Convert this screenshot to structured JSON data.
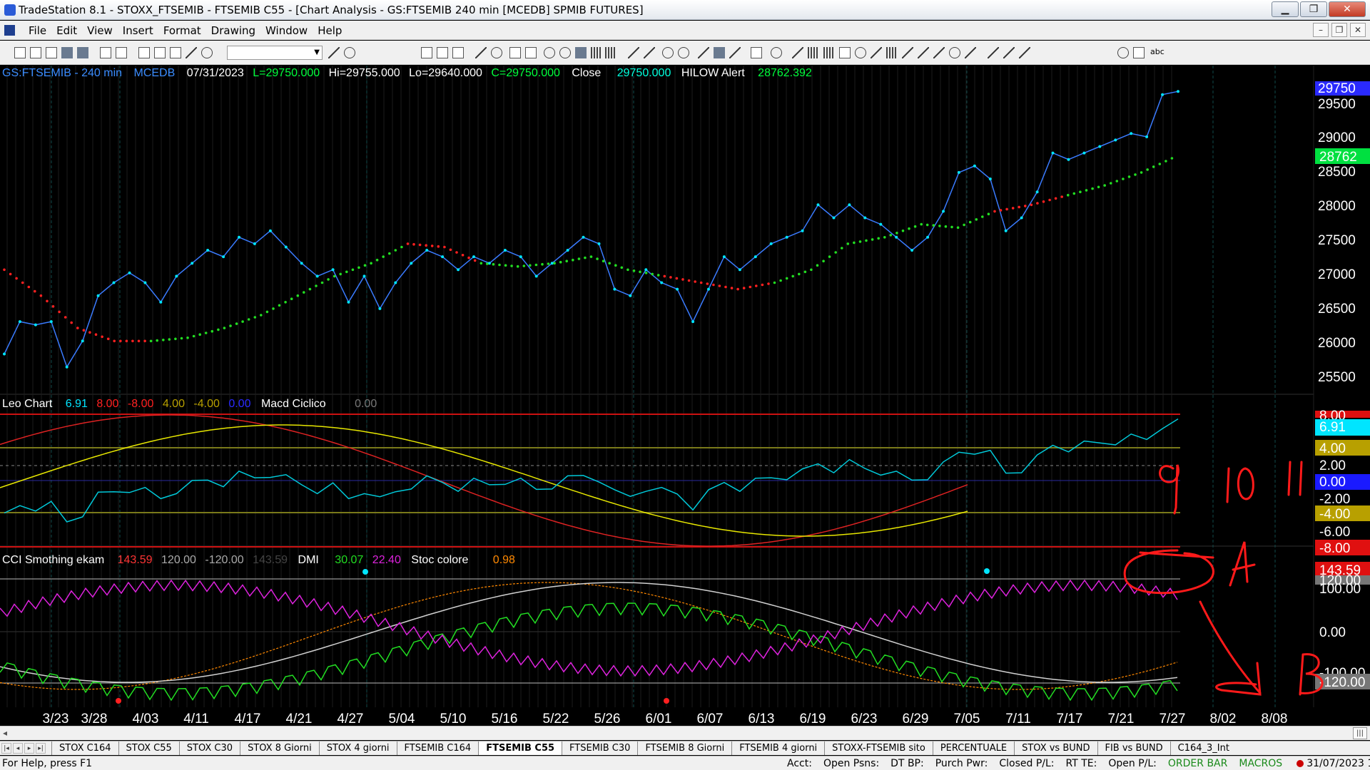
{
  "window": {
    "title": "TradeStation 8.1 - STOXX_FTSEMIB - FTSEMIB C55 - [Chart Analysis - GS:FTSEMIB  240 min  [MCEDB] SPMIB FUTURES]",
    "min_glyph": "▁",
    "max_glyph": "❐",
    "close_glyph": "✕"
  },
  "menu": {
    "items": [
      "File",
      "Edit",
      "View",
      "Insert",
      "Format",
      "Drawing",
      "Window",
      "Help"
    ],
    "mdi_min": "–",
    "mdi_restore": "❐",
    "mdi_close": "✕"
  },
  "toolbar": {
    "combo_value": "",
    "text_tool_label": "abc"
  },
  "chart": {
    "header": {
      "symbol": "GS:FTSEMIB - 240 min",
      "source": "MCEDB",
      "date": "07/31/2023",
      "low_open": "L=29750.000",
      "hi": "Hi=29755.000",
      "lo": "Lo=29640.000",
      "close_c": "C=29750.000",
      "close_label": "Close",
      "close_value": "29750.000",
      "alert_label": "HILOW Alert",
      "alert_value": "28762.392"
    },
    "panel2": {
      "name": "Leo Chart",
      "v1": "6.91",
      "v2": "8.00",
      "v3": "-8.00",
      "v4": "4.00",
      "v5": "-4.00",
      "v6": "0.00",
      "name2": "Macd Ciclico",
      "v7": "0.00"
    },
    "panel3": {
      "name": "CCI Smothing ekam",
      "v1": "143.59",
      "v2": "120.00",
      "v3": "-120.00",
      "v4": "143.59",
      "name2": "DMI",
      "v5": "30.07",
      "v6": "22.40",
      "name3": "Stoc colore",
      "v7": "0.98"
    },
    "price_axis": {
      "ticks": [
        "29500",
        "29000",
        "28500",
        "28000",
        "27500",
        "27000",
        "26500",
        "26000",
        "25500"
      ],
      "last_price_label": "29750",
      "alert_label": "28762"
    },
    "panel2_axis": {
      "ticks": [
        "4.00",
        "2.00",
        "0.00",
        "-2.00",
        "-4.00",
        "-6.00",
        "-8.00"
      ],
      "top_label": "8.00",
      "value_label": "6.91"
    },
    "panel3_axis": {
      "ticks": [
        "100.00",
        "0.00",
        "-100.00"
      ],
      "labels": [
        "143.59",
        "120.00",
        "-120.00"
      ]
    },
    "x_axis": [
      "3/23",
      "3/28",
      "4/03",
      "4/11",
      "4/17",
      "4/21",
      "4/27",
      "5/04",
      "5/10",
      "5/16",
      "5/22",
      "5/26",
      "6/01",
      "6/07",
      "6/13",
      "6/19",
      "6/23",
      "6/29",
      "7/05",
      "7/11",
      "7/17",
      "7/21",
      "7/27",
      "8/02",
      "8/08"
    ],
    "annotations": [
      "9",
      "10",
      "11",
      "A",
      "B"
    ],
    "colors": {
      "price": "#00e5ff",
      "support": "#22dd22",
      "resistance": "#ff2020",
      "header_blue": "#3a8cff",
      "header_green": "#00ff3c",
      "cci": "#d0d0d0",
      "dmi_plus": "#22dd22",
      "dmi_minus": "#dd22dd",
      "stoc": "#ff8800",
      "leo_yellow": "#e6e600"
    }
  },
  "chart_data": {
    "type": "line",
    "title": "GS:FTSEMIB - 240 min",
    "x_ticks": [
      "3/23",
      "3/28",
      "4/03",
      "4/11",
      "4/17",
      "4/21",
      "4/27",
      "5/04",
      "5/10",
      "5/16",
      "5/22",
      "5/26",
      "6/01",
      "6/07",
      "6/13",
      "6/19",
      "6/23",
      "6/29",
      "7/05",
      "7/11",
      "7/17",
      "7/21",
      "7/27",
      "8/02",
      "8/08"
    ],
    "ylim": [
      25200,
      29950
    ],
    "series": [
      {
        "name": "Close",
        "values": [
          25700,
          26200,
          26150,
          26200,
          25500,
          25900,
          26600,
          26800,
          26950,
          26800,
          26500,
          26900,
          27100,
          27300,
          27200,
          27500,
          27400,
          27600,
          27350,
          27100,
          26900,
          27000,
          26500,
          26900,
          26400,
          26800,
          27100,
          27300,
          27200,
          27000,
          27200,
          27100,
          27300,
          27200,
          26900,
          27100,
          27300,
          27500,
          27400,
          26700,
          26600,
          27000,
          26800,
          26700,
          26200,
          26700,
          27200,
          27000,
          27200,
          27400,
          27500,
          27600,
          28000,
          27800,
          28000,
          27800,
          27700,
          27500,
          27300,
          27500,
          27900,
          28500,
          28600,
          28400,
          27600,
          27800,
          28200,
          28800,
          28700,
          28800,
          28900,
          29000,
          29100,
          29050,
          29700,
          29750
        ]
      },
      {
        "name": "HILOW Alert",
        "values": [
          27000,
          26600,
          26100,
          25900,
          25900,
          25950,
          26100,
          26300,
          26600,
          26900,
          27100,
          27400,
          27350,
          27100,
          27050,
          27100,
          27200,
          27000,
          26900,
          26800,
          26700,
          26800,
          27000,
          27400,
          27500,
          27700,
          27650,
          27900,
          28000,
          28150,
          28300,
          28500,
          28762
        ]
      }
    ]
  }
}
